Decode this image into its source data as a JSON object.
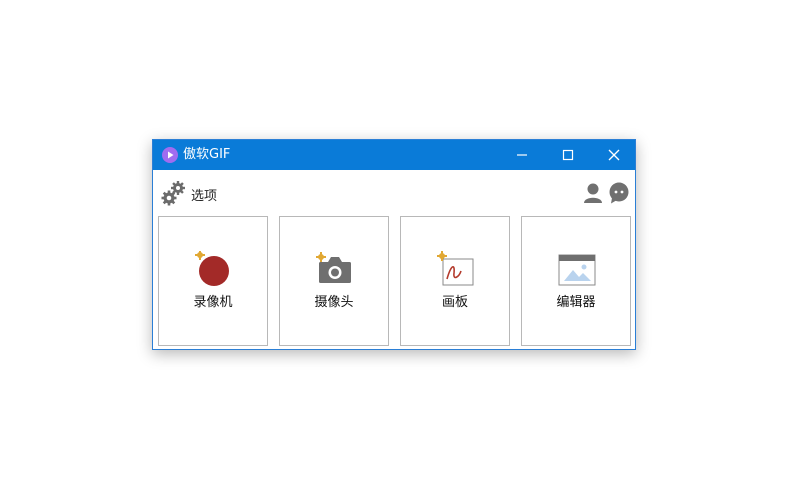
{
  "window": {
    "title": "傲软GIF",
    "accent_color": "#0a7bd8",
    "controls": [
      "minimize-icon",
      "maximize-icon",
      "close-icon"
    ]
  },
  "toolbar": {
    "options_label": "选项",
    "icons": [
      "gear-icon",
      "user-icon",
      "chat-icon"
    ]
  },
  "tiles": [
    {
      "label": "录像机",
      "icon": "record-icon"
    },
    {
      "label": "摄像头",
      "icon": "camera-icon"
    },
    {
      "label": "画板",
      "icon": "canvas-icon"
    },
    {
      "label": "编辑器",
      "icon": "editor-icon"
    }
  ]
}
